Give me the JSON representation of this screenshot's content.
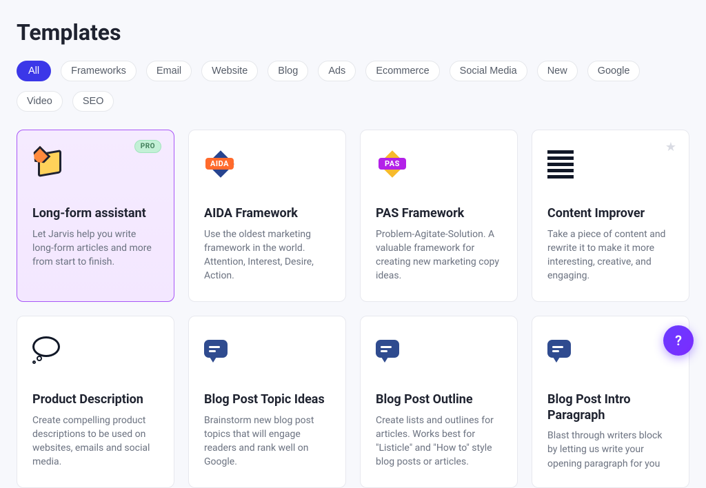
{
  "page": {
    "title": "Templates"
  },
  "filters": [
    {
      "label": "All",
      "active": true
    },
    {
      "label": "Frameworks",
      "active": false
    },
    {
      "label": "Email",
      "active": false
    },
    {
      "label": "Website",
      "active": false
    },
    {
      "label": "Blog",
      "active": false
    },
    {
      "label": "Ads",
      "active": false
    },
    {
      "label": "Ecommerce",
      "active": false
    },
    {
      "label": "Social Media",
      "active": false
    },
    {
      "label": "New",
      "active": false
    },
    {
      "label": "Google",
      "active": false
    },
    {
      "label": "Video",
      "active": false
    },
    {
      "label": "SEO",
      "active": false
    }
  ],
  "badges": {
    "pro": "PRO"
  },
  "cards": [
    {
      "title": "Long-form assistant",
      "desc": "Let Jarvis help you write long-form articles and more from start to finish."
    },
    {
      "title": "AIDA Framework",
      "desc": "Use the oldest marketing framework in the world. Attention, Interest, Desire, Action.",
      "iconLabel": "AIDA"
    },
    {
      "title": "PAS Framework",
      "desc": "Problem-Agitate-Solution. A valuable framework for creating new marketing copy ideas.",
      "iconLabel": "PAS"
    },
    {
      "title": "Content Improver",
      "desc": "Take a piece of content and rewrite it to make it more interesting, creative, and engaging."
    },
    {
      "title": "Product Description",
      "desc": "Create compelling product descriptions to be used on websites, emails and social media."
    },
    {
      "title": "Blog Post Topic Ideas",
      "desc": "Brainstorm new blog post topics that will engage readers and rank well on Google."
    },
    {
      "title": "Blog Post Outline",
      "desc": "Create lists and outlines for articles. Works best for \"Listicle\" and \"How to\" style blog posts or articles."
    },
    {
      "title": "Blog Post Intro Paragraph",
      "desc": "Blast through writers block by letting us write your opening paragraph for you"
    }
  ],
  "help": {
    "label": "?"
  }
}
